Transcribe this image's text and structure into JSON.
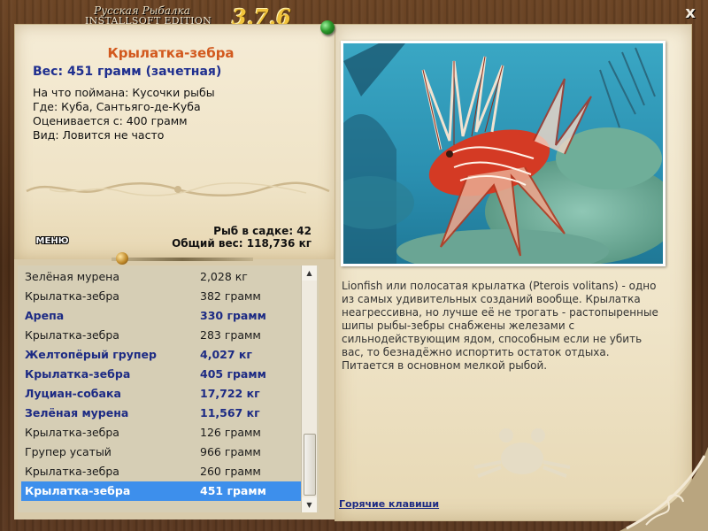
{
  "window": {
    "logo_line1": "Русская Рыбалка",
    "logo_line2": "INSTALLSOFT EDITION",
    "version": "3.7.6",
    "close_label": "x"
  },
  "catch": {
    "title": "Крылатка-зебра",
    "weight_line": "Вес: 451 грамм (зачетная)",
    "bait": "На что поймана: Кусочки рыбы",
    "location": "Где: Куба, Сантьяго-де-Куба",
    "rated_from": "Оценивается с: 400 грамм",
    "type": "Вид: Ловится не часто"
  },
  "stats": {
    "fish_in_net": "Рыб в садке: 42",
    "total_weight": "Общий вес: 118,736 кг"
  },
  "menu_label": "МЕНЮ",
  "list": {
    "rows": [
      {
        "name": "Зелёная мурена",
        "weight": "2,028 кг",
        "bold": false
      },
      {
        "name": "Крылатка-зебра",
        "weight": "382 грамм",
        "bold": false
      },
      {
        "name": "Арепа",
        "weight": "330 грамм",
        "bold": true
      },
      {
        "name": "Крылатка-зебра",
        "weight": "283 грамм",
        "bold": false
      },
      {
        "name": "Желтопёрый групер",
        "weight": "4,027 кг",
        "bold": true
      },
      {
        "name": "Крылатка-зебра",
        "weight": "405 грамм",
        "bold": true
      },
      {
        "name": "Луциан-собака",
        "weight": "17,722 кг",
        "bold": true
      },
      {
        "name": "Зелёная мурена",
        "weight": "11,567 кг",
        "bold": true
      },
      {
        "name": "Крылатка-зебра",
        "weight": "126 грамм",
        "bold": false
      },
      {
        "name": "Групер усатый",
        "weight": "966 грамм",
        "bold": false
      },
      {
        "name": "Крылатка-зебра",
        "weight": "260 грамм",
        "bold": false
      },
      {
        "name": "Крылатка-зебра",
        "weight": "451 грамм",
        "bold": true,
        "selected": true
      }
    ]
  },
  "description": "Lionfish или полосатая крылатка (Pterois volitans) - одно из самых удивительных созданий вообще. Крылатка неагрессивна, но лучше её не трогать - растопыренные шипы рыбы-зебры снабжены железами с сильнодействующим ядом, способным если не убить вас, то безнадёжно испортить остаток отдыха. Питается в основном мелкой рыбой.",
  "hotkeys_label": "Горячие клавиши",
  "colors": {
    "title_orange": "#d2591e",
    "bold_blue": "#1d2b84",
    "selection_blue": "#3d8fec",
    "version_gold": "#f1c33b",
    "parchment": "#f5ecd6"
  },
  "icons": [
    "close-icon",
    "pin-icon",
    "scroll-up-icon",
    "scroll-down-icon",
    "crab-icon"
  ]
}
